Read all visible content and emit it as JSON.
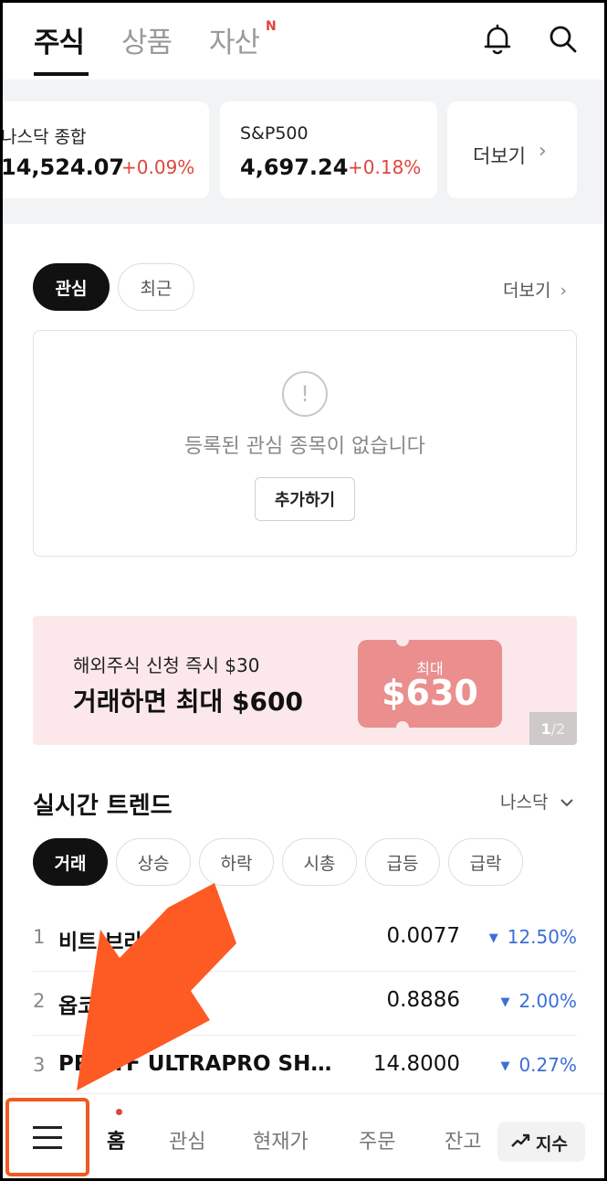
{
  "header": {
    "tabs": [
      {
        "label": "주식"
      },
      {
        "label": "상품"
      },
      {
        "label": "자산"
      }
    ],
    "new_badge": "N"
  },
  "indices": [
    {
      "name": "나스닥 종합",
      "value": "14,524.07",
      "change": "+0.09%"
    },
    {
      "name": "S&P500",
      "value": "4,697.24",
      "change": "+0.18%"
    }
  ],
  "indices_more": "더보기",
  "watchlist": {
    "tabs": [
      {
        "label": "관심"
      },
      {
        "label": "최근"
      }
    ],
    "more": "더보기",
    "empty_text": "등록된 관심 종목이 없습니다",
    "add_button": "추가하기",
    "empty_icon": "!"
  },
  "banner": {
    "line1": "해외주식 신청 즉시 $30",
    "line2": "거래하면 최대 $600",
    "coupon_label": "최대",
    "coupon_amount": "$630",
    "page_current": "1",
    "page_total": "/2"
  },
  "trend": {
    "title": "실시간 트렌드",
    "market": "나스닥",
    "filters": [
      {
        "label": "거래"
      },
      {
        "label": "상승"
      },
      {
        "label": "하락"
      },
      {
        "label": "시총"
      },
      {
        "label": "급등"
      },
      {
        "label": "급락"
      }
    ],
    "rows": [
      {
        "rank": "1",
        "name": "비트 브라",
        "price": "0.0077",
        "change": "12.50%"
      },
      {
        "rank": "2",
        "name": "옵코",
        "price": "0.8886",
        "change": "2.00%"
      },
      {
        "rank": "3",
        "name": "PR ETF ULTRAPRO SH…",
        "price": "14.8000",
        "change": "0.27%"
      }
    ]
  },
  "bottom_nav": {
    "items": [
      {
        "label": "홈"
      },
      {
        "label": "관심"
      },
      {
        "label": "현재가"
      },
      {
        "label": "주문"
      },
      {
        "label": "잔고"
      }
    ],
    "index_button": "지수"
  },
  "colors": {
    "up": "#e0453f",
    "down": "#3b6fd6",
    "highlight": "#f05a22",
    "banner_bg": "#fce8ea",
    "coupon": "#ea8e8e"
  }
}
